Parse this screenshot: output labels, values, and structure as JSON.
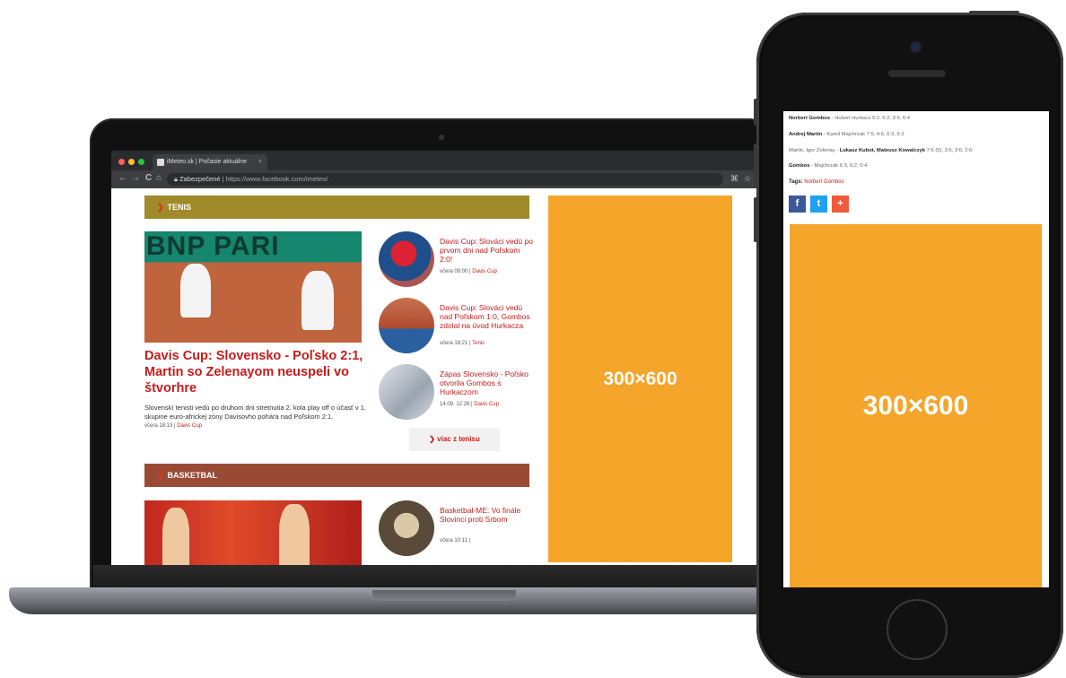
{
  "browser": {
    "tab_title": "iMeteo.sk | Počasie aktuálne",
    "tab_close": "×",
    "back": "←",
    "forward": "→",
    "reload": "C",
    "home": "⌂",
    "secure_label": "Zabezpečené",
    "url": "https://www.facebook.com/imeteo/",
    "ext_icon": "⌘",
    "star_icon": "☆"
  },
  "laptop_page": {
    "tenis_section": "TENIS",
    "hero_banner": "BNP PARI",
    "hero_title": "Davis Cup: Slovensko - Poľsko 2:1, Martin so Zelenayom neuspeli vo štvorhre",
    "hero_text": "Slovenskí tenisti vedú po druhom dni stretnutia 2. kola play off o účasť v 1. skupine euro-africkej zóny Davisovho pohára nad Poľskom 2:1.",
    "hero_meta_time": "včera 18:13 | ",
    "hero_meta_cat": "Davis Cup",
    "side_items": [
      {
        "title": "Davis Cup: Slováci vedú po prvom dni nad Poľskom 2:0!",
        "meta_time": "včera 09:00 | ",
        "meta_cat": "Davis Cup"
      },
      {
        "title": "Davis Cup: Slováci vedú nad Poľskom 1:0, Gombos zdolal na úvod Hurkacza",
        "meta_time": "včera 18:21 | ",
        "meta_cat": "Tenis"
      },
      {
        "title": "Zápas Slovensko - Poľsko otvorila Gombos s Hurkaczom",
        "meta_time": "14.09. 12:26 | ",
        "meta_cat": "Davis Cup"
      }
    ],
    "more_button": "viac z tenisu",
    "basketbal_section": "BASKETBAL",
    "basket_item": {
      "title": "Basketbal-ME: Vo finále Slovinci proti Srbom",
      "meta_time": "včera 10:11 | ",
      "meta_cat": ""
    },
    "ad_label": "300×600"
  },
  "phone_page": {
    "results": [
      {
        "bold": "Norbert Gombos",
        "rest": " - Hubert Hurkacz 6:2, 6:2, 3:6, 6:4"
      },
      {
        "bold": "Andrej Martin",
        "rest": " - Kamil Majchrzak 7:5, 4:6, 6:3, 6:3"
      },
      {
        "pre": "Martin, Igor Zelenay - ",
        "bold": "Lukasz Kubot, Mateusz Kowalczyk",
        "rest": " 7:6 (5), 3:6, 3:6, 2:6"
      },
      {
        "bold": "Gombos",
        "rest": " - Majchrzak 6:3, 6:2, 6:4"
      }
    ],
    "tags_label": "Tags:",
    "tag": "Norbert Gombos",
    "share_facebook": "f",
    "share_twitter": "t",
    "share_plus": "+",
    "ad_label": "300×600"
  },
  "colors": {
    "tenis_bar": "#a08a2a",
    "basketbal_bar": "#9a4a34",
    "ad": "#f4a52a",
    "accent_red": "#c61c1c",
    "facebook": "#3b5998",
    "twitter": "#1da1f2",
    "plus": "#f05a3c"
  }
}
